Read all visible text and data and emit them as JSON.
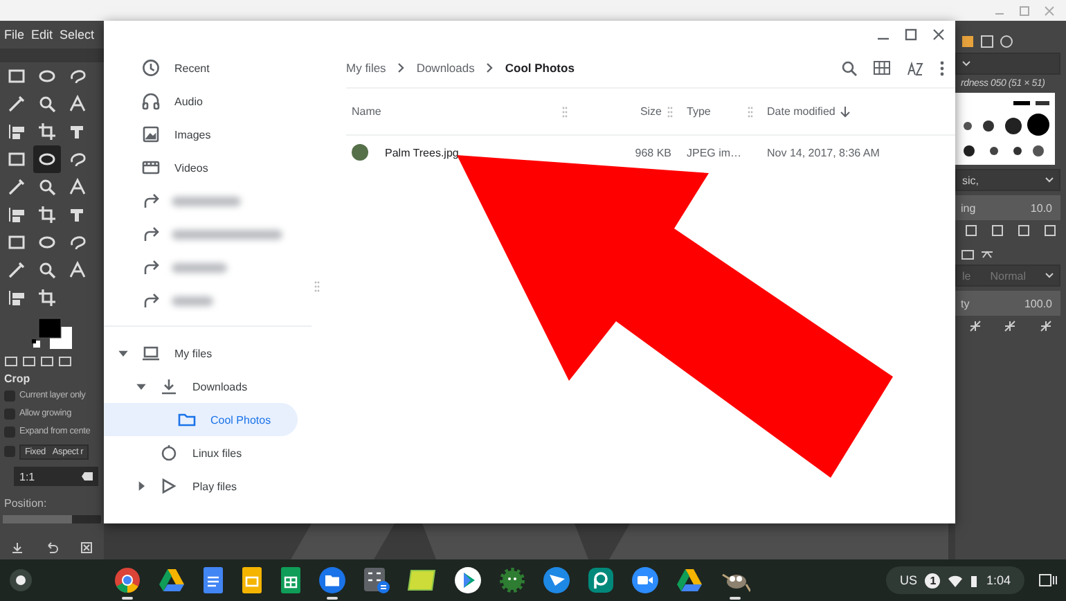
{
  "gimp": {
    "menu": [
      "File",
      "Edit",
      "Select"
    ],
    "tools": [
      {
        "selected": false
      },
      {
        "selected": false
      },
      {
        "selected": false
      },
      {
        "selected": false
      },
      {
        "selected": false
      },
      {
        "selected": false
      },
      {
        "selected": false
      },
      {
        "selected": false
      },
      {
        "selected": false
      },
      {
        "selected": false
      },
      {
        "selected": true
      },
      {
        "selected": false
      },
      {
        "selected": false
      },
      {
        "selected": false
      },
      {
        "selected": false
      },
      {
        "selected": false
      },
      {
        "selected": false
      },
      {
        "selected": false
      },
      {
        "selected": false
      },
      {
        "selected": false
      },
      {
        "selected": false
      },
      {
        "selected": false
      },
      {
        "selected": false
      },
      {
        "selected": false
      },
      {
        "selected": false
      },
      {
        "selected": false
      }
    ],
    "tool_options": {
      "title": "Crop",
      "options": [
        {
          "label": "Current layer only",
          "checked": false
        },
        {
          "label": "Allow growing",
          "checked": false
        },
        {
          "label": "Expand from cente",
          "checked": false
        }
      ],
      "fixed": {
        "checked": false,
        "label": "Fixed",
        "value": "Aspect r"
      },
      "ratio": "1:1",
      "position_label": "Position:"
    },
    "brushes": {
      "title": "rdness 050 (51 × 51)",
      "preset": "sic,",
      "spacing_label": "ing",
      "spacing": "10.0"
    },
    "layers": {
      "mode_label": "le",
      "mode": "Normal",
      "opacity_label": "ty",
      "opacity": "100.0"
    }
  },
  "dialog": {
    "sidebar": [
      {
        "kind": "recent",
        "label": "Recent",
        "selected": false
      },
      {
        "kind": "audio",
        "label": "Audio",
        "selected": false
      },
      {
        "kind": "images",
        "label": "Images",
        "selected": false
      },
      {
        "kind": "videos",
        "label": "Videos",
        "selected": false
      },
      {
        "kind": "shortcut",
        "selected": false
      },
      {
        "kind": "shortcut",
        "selected": false
      },
      {
        "kind": "shortcut",
        "selected": false
      },
      {
        "kind": "shortcut",
        "selected": false
      }
    ],
    "tree": [
      {
        "kind": "my-files",
        "label": "My files",
        "expanded": true,
        "selected": false,
        "children": [
          {
            "kind": "downloads",
            "label": "Downloads",
            "expanded": true,
            "selected": false,
            "children": [
              {
                "kind": "folder",
                "label": "Cool Photos",
                "selected": true
              }
            ]
          },
          {
            "kind": "linux",
            "label": "Linux files",
            "selected": false
          },
          {
            "kind": "play",
            "label": "Play files",
            "expanded": false,
            "selected": false
          }
        ]
      }
    ],
    "breadcrumb": [
      "My files",
      "Downloads",
      "Cool Photos"
    ],
    "columns": [
      {
        "label": "Name",
        "sorted": false
      },
      {
        "label": "Size",
        "sorted": false
      },
      {
        "label": "Type",
        "sorted": false
      },
      {
        "label": "Date modified",
        "sorted": true
      }
    ],
    "files": [
      {
        "name": "Palm Trees.jpg",
        "size": "968 KB",
        "type": "JPEG im…",
        "date": "Nov 14, 2017, 8:36 AM",
        "selected": false
      }
    ]
  },
  "shelf": {
    "apps": [
      {
        "kind": "chrome",
        "running": true
      },
      {
        "kind": "drive",
        "running": false
      },
      {
        "kind": "docs",
        "running": false
      },
      {
        "kind": "slides",
        "running": false
      },
      {
        "kind": "sheets",
        "running": false
      },
      {
        "kind": "files",
        "running": true
      },
      {
        "kind": "calculator",
        "running": false
      },
      {
        "kind": "notes",
        "running": false
      },
      {
        "kind": "play",
        "running": false
      },
      {
        "kind": "gear",
        "running": false
      },
      {
        "kind": "send",
        "running": false
      },
      {
        "kind": "teal",
        "running": false
      },
      {
        "kind": "zoom",
        "running": false
      },
      {
        "kind": "drive",
        "running": false
      },
      {
        "kind": "gimp",
        "running": true
      }
    ],
    "tray": {
      "keyboard": "US",
      "notifications": "1",
      "time": "1:04"
    }
  }
}
